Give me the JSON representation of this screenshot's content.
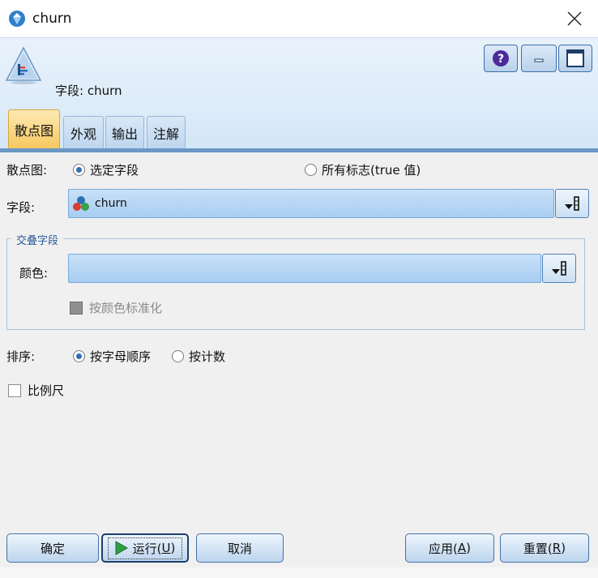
{
  "window": {
    "title": "churn",
    "close_glyph": "✕"
  },
  "header": {
    "node_label": "字段: churn",
    "buttons": {
      "help": "?",
      "minimize": "-",
      "maximize": "□"
    }
  },
  "tabs": [
    {
      "label": "散点图",
      "active": true
    },
    {
      "label": "外观",
      "active": false
    },
    {
      "label": "输出",
      "active": false
    },
    {
      "label": "注解",
      "active": false
    }
  ],
  "scatter": {
    "label": "散点图:",
    "options": [
      {
        "label": "选定字段",
        "checked": true
      },
      {
        "label": "所有标志(true 值)",
        "checked": false
      }
    ]
  },
  "field": {
    "label": "字段:",
    "value": "churn"
  },
  "overlay": {
    "title": "交叠字段",
    "color_label": "颜色:",
    "color_value": "",
    "normalize_label": "按颜色标准化",
    "normalize_checked": true,
    "normalize_disabled": true
  },
  "sort": {
    "label": "排序:",
    "options": [
      {
        "label": "按字母顺序",
        "checked": true
      },
      {
        "label": "按计数",
        "checked": false
      }
    ]
  },
  "scale": {
    "label": "比例尺",
    "checked": false
  },
  "footer": {
    "ok": "确定",
    "run_prefix": "运行(",
    "run_key": "U",
    "run_suffix": ")",
    "cancel": "取消",
    "apply_prefix": "应用(",
    "apply_key": "A",
    "apply_suffix": ")",
    "reset_prefix": "重置(",
    "reset_key": "R",
    "reset_suffix": ")"
  },
  "colors": {
    "accent": "#2f6fb6",
    "tab_active": "#f7c860",
    "field_bg": "#b4d5f3"
  }
}
